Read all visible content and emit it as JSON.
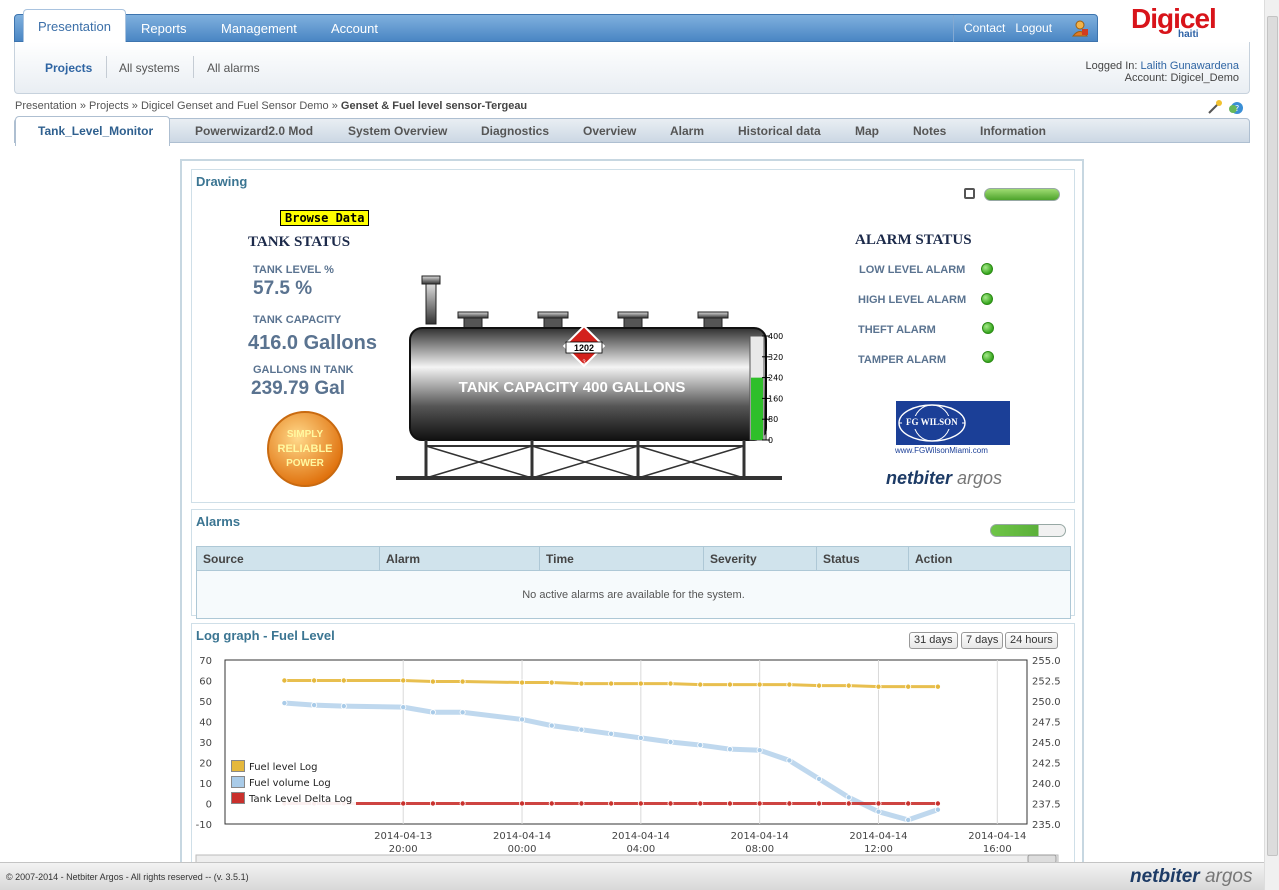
{
  "topnav": {
    "tabs": [
      "Presentation",
      "Reports",
      "Management",
      "Account"
    ],
    "contact": "Contact",
    "logout": "Logout"
  },
  "brand": {
    "name": "Digicel",
    "sub": "haiti"
  },
  "subnav": {
    "items": [
      "Projects",
      "All systems",
      "All alarms"
    ],
    "logged_in_label": "Logged In:",
    "logged_in_user": "Lalith Gunawardena",
    "account_label": "Account:",
    "account": "Digicel_Demo"
  },
  "breadcrumb": {
    "path": "Presentation » Projects » Digicel Genset and Fuel Sensor Demo »",
    "current": "Genset & Fuel level sensor-Tergeau"
  },
  "tabs": [
    "Tank_Level_Monitor",
    "Powerwizard2.0 Mod",
    "System Overview",
    "Diagnostics",
    "Overview",
    "Alarm",
    "Historical data",
    "Map",
    "Notes",
    "Information"
  ],
  "drawing": {
    "title": "Drawing",
    "browse": "Browse Data",
    "tank_status": "TANK STATUS",
    "level_label": "TANK LEVEL %",
    "level_value": "57.5 %",
    "capacity_label": "TANK CAPACITY",
    "capacity_value": "416.0 Gallons",
    "gallons_label": "GALLONS IN TANK",
    "gallons_value": "239.79 Gal",
    "tank_text": "TANK CAPACITY 400 GALLONS",
    "hazmat": "1202",
    "hazmat_class": "3",
    "gauge_ticks": [
      "400",
      "320",
      "240",
      "160",
      "80",
      "0"
    ],
    "gauge_fill": 0.5995,
    "badge": [
      "SIMPLY",
      "RELIABLE",
      "POWER"
    ],
    "alarm_status": "ALARM STATUS",
    "alarms": [
      "LOW LEVEL ALARM",
      "HIGH LEVEL ALARM",
      "THEFT ALARM",
      "TAMPER ALARM"
    ],
    "fg_wilson": "FG WILSON",
    "fg_url": "www.FGWilsonMiami.com",
    "netbiter": "netbiter",
    "argos": "argos"
  },
  "alarms_panel": {
    "title": "Alarms",
    "columns": [
      "Source",
      "Alarm",
      "Time",
      "Severity",
      "Status",
      "Action"
    ],
    "empty": "No active alarms are available for the system."
  },
  "log": {
    "title": "Log graph - Fuel Level",
    "ranges": [
      "31 days",
      "7 days",
      "24 hours"
    ]
  },
  "chart_data": {
    "type": "line",
    "ylim_left": [
      -10,
      70
    ],
    "ylim_right": [
      235.0,
      255.0
    ],
    "yticks_left": [
      "70",
      "60",
      "50",
      "40",
      "30",
      "20",
      "10",
      "0",
      "-10"
    ],
    "yticks_right": [
      "255.0",
      "252.5",
      "250.0",
      "247.5",
      "245.0",
      "242.5",
      "240.0",
      "237.5",
      "235.0"
    ],
    "xticks": [
      {
        "date": "2014-04-13",
        "time": "20:00"
      },
      {
        "date": "2014-04-14",
        "time": "00:00"
      },
      {
        "date": "2014-04-14",
        "time": "04:00"
      },
      {
        "date": "2014-04-14",
        "time": "08:00"
      },
      {
        "date": "2014-04-14",
        "time": "12:00"
      },
      {
        "date": "2014-04-14",
        "time": "16:00"
      }
    ],
    "x_hours_from_first": [
      -4,
      -3,
      -2,
      0,
      1,
      2,
      4,
      5,
      6,
      7,
      8,
      9,
      10,
      11,
      12,
      13,
      14,
      15,
      16,
      17,
      18
    ],
    "series": [
      {
        "name": "Fuel level Log",
        "color": "#e5b83c",
        "axis": "left",
        "values": [
          60,
          60,
          60,
          60,
          59.5,
          59.5,
          59,
          59,
          58.5,
          58.5,
          58.5,
          58.5,
          58,
          58,
          58,
          58,
          57.5,
          57.5,
          57,
          57,
          57
        ]
      },
      {
        "name": "Fuel volume Log",
        "color": "#a9cbe8",
        "axis": "left",
        "values": [
          49,
          48,
          47.5,
          47,
          44.5,
          44.5,
          41,
          38,
          36,
          34,
          32,
          30,
          28.5,
          26.5,
          26,
          21,
          12,
          3,
          -4,
          -8,
          -3
        ]
      },
      {
        "name": "Tank Level Delta Log",
        "color": "#c9302c",
        "axis": "left",
        "values": [
          0,
          0,
          0,
          0,
          0,
          0,
          0,
          0,
          0,
          0,
          0,
          0,
          0,
          0,
          0,
          0,
          0,
          0,
          0,
          0,
          0
        ]
      }
    ]
  },
  "footer": {
    "copyright": "© 2007-2014 - Netbiter Argos - All rights reserved -- (v. 3.5.1)",
    "netbiter": "netbiter",
    "argos": "argos"
  }
}
